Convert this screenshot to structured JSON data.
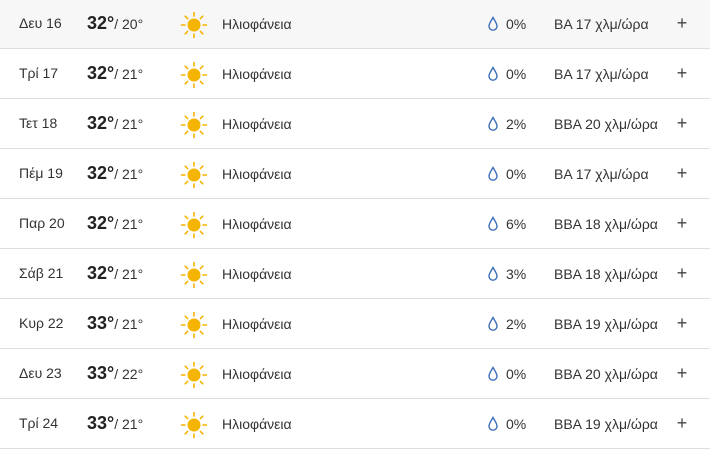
{
  "forecast": {
    "days": [
      {
        "day": "Δευ 16",
        "high": "32°",
        "low": "/ 20°",
        "condition": "Ηλιοφάνεια",
        "icon": "sun-icon",
        "precip": "0%",
        "wind": "ΒΑ 17 χλμ/ώρα",
        "expand": "+"
      },
      {
        "day": "Τρί 17",
        "high": "32°",
        "low": "/ 21°",
        "condition": "Ηλιοφάνεια",
        "icon": "sun-icon",
        "precip": "0%",
        "wind": "ΒΑ 17 χλμ/ώρα",
        "expand": "+"
      },
      {
        "day": "Τετ 18",
        "high": "32°",
        "low": "/ 21°",
        "condition": "Ηλιοφάνεια",
        "icon": "sun-icon",
        "precip": "2%",
        "wind": "ΒΒΑ 20 χλμ/ώρα",
        "expand": "+"
      },
      {
        "day": "Πέμ 19",
        "high": "32°",
        "low": "/ 21°",
        "condition": "Ηλιοφάνεια",
        "icon": "sun-icon",
        "precip": "0%",
        "wind": "ΒΑ 17 χλμ/ώρα",
        "expand": "+"
      },
      {
        "day": "Παρ 20",
        "high": "32°",
        "low": "/ 21°",
        "condition": "Ηλιοφάνεια",
        "icon": "sun-icon",
        "precip": "6%",
        "wind": "ΒΒΑ 18 χλμ/ώρα",
        "expand": "+"
      },
      {
        "day": "Σάβ 21",
        "high": "32°",
        "low": "/ 21°",
        "condition": "Ηλιοφάνεια",
        "icon": "sun-icon",
        "precip": "3%",
        "wind": "ΒΒΑ 18 χλμ/ώρα",
        "expand": "+"
      },
      {
        "day": "Κυρ 22",
        "high": "33°",
        "low": "/ 21°",
        "condition": "Ηλιοφάνεια",
        "icon": "sun-icon",
        "precip": "2%",
        "wind": "ΒΒΑ 19 χλμ/ώρα",
        "expand": "+"
      },
      {
        "day": "Δευ 23",
        "high": "33°",
        "low": "/ 22°",
        "condition": "Ηλιοφάνεια",
        "icon": "sun-icon",
        "precip": "0%",
        "wind": "ΒΒΑ 20 χλμ/ώρα",
        "expand": "+"
      },
      {
        "day": "Τρί 24",
        "high": "33°",
        "low": "/ 21°",
        "condition": "Ηλιοφάνεια",
        "icon": "sun-icon",
        "precip": "0%",
        "wind": "ΒΒΑ 19 χλμ/ώρα",
        "expand": "+"
      }
    ]
  },
  "colors": {
    "sun": "#f5b400",
    "drop": "#3d6fb8",
    "divider": "#dedede"
  }
}
